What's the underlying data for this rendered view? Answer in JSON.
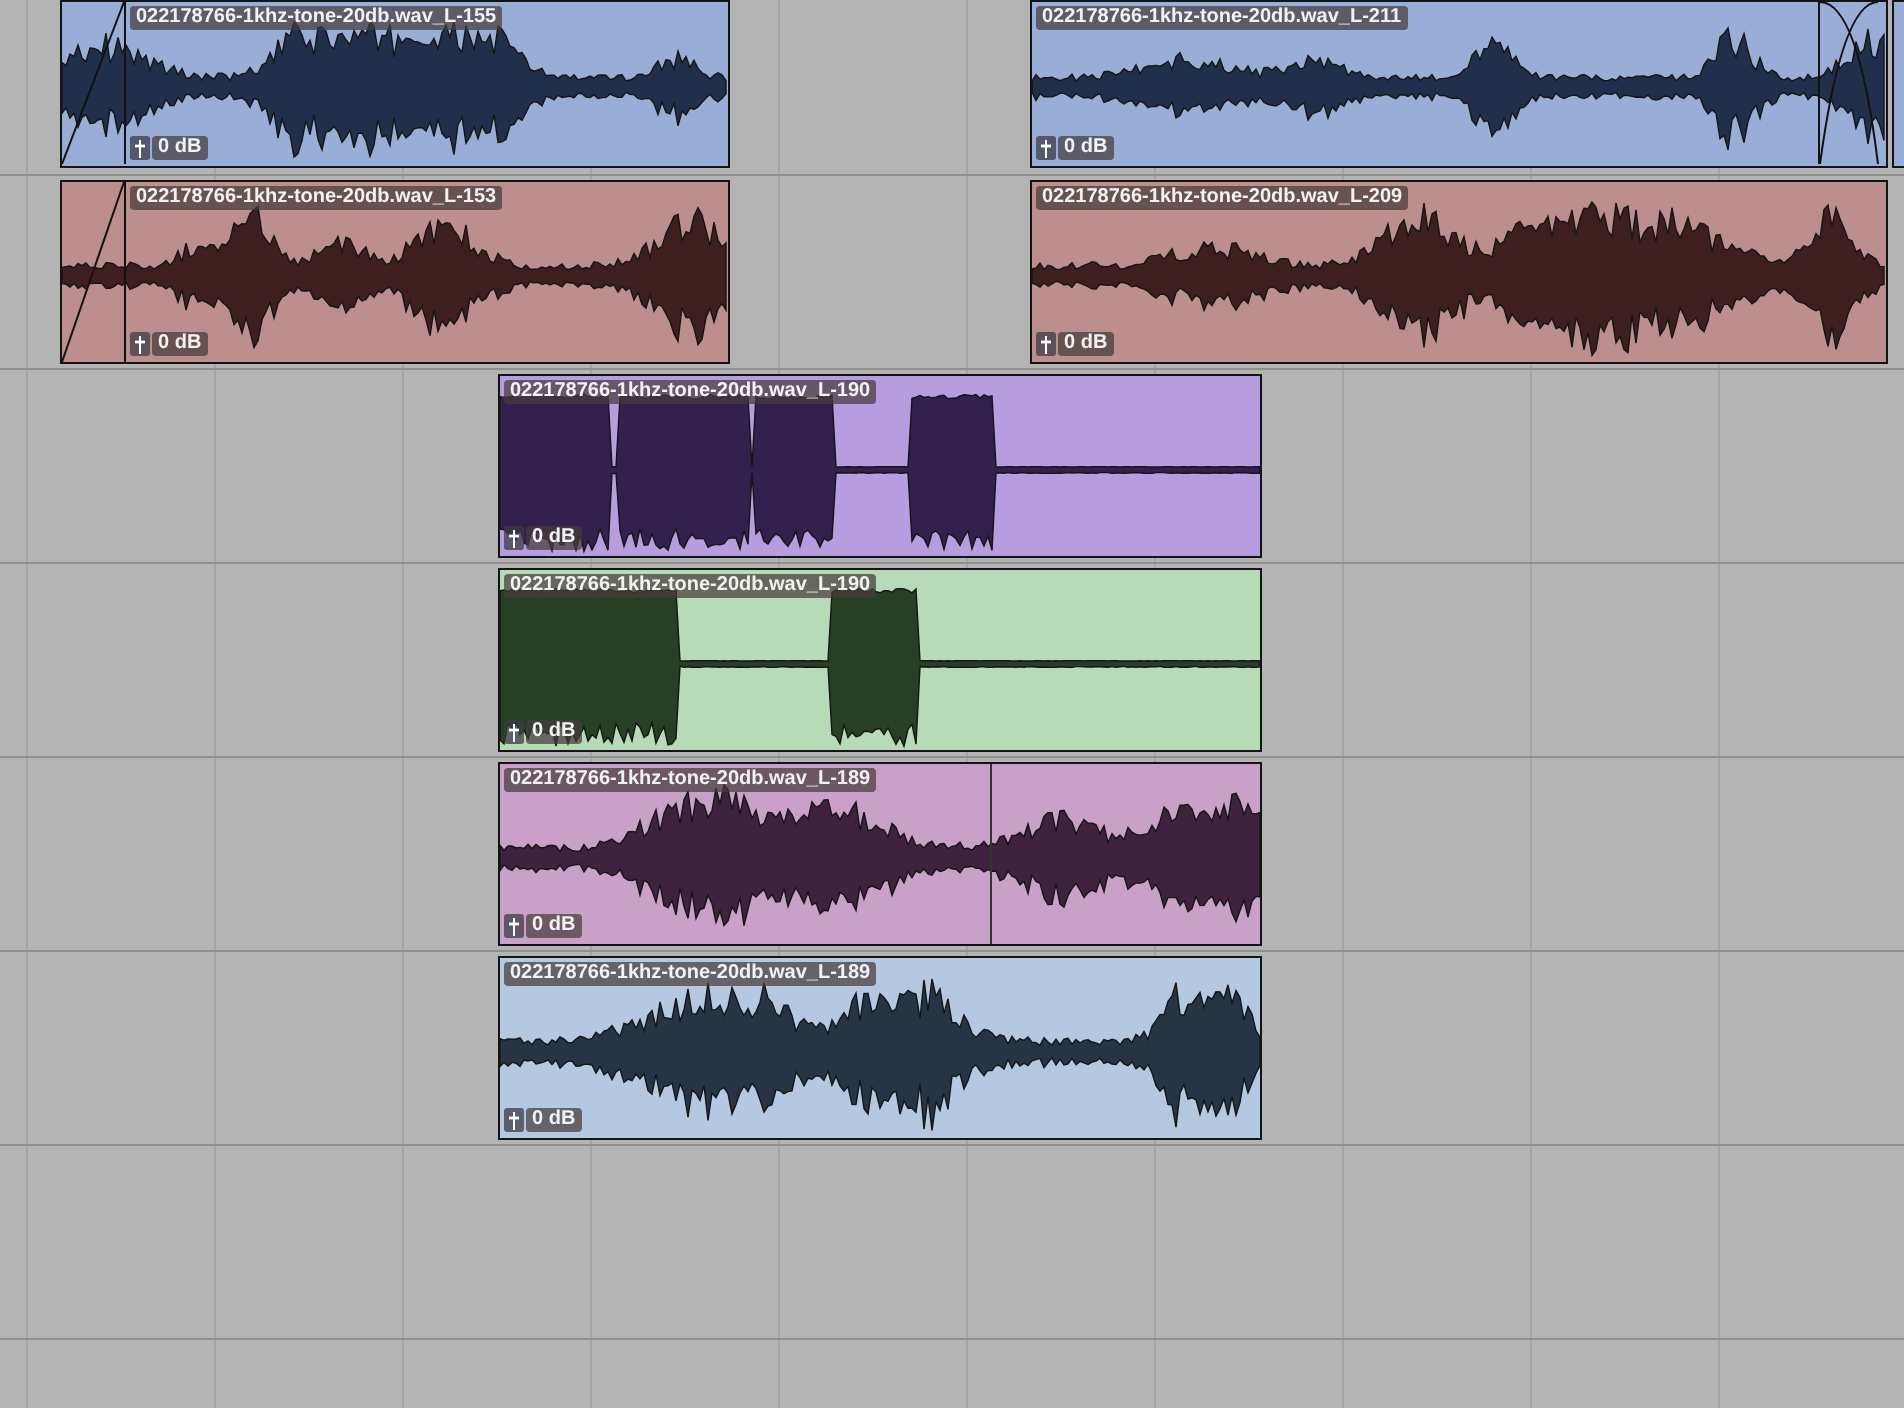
{
  "lanes": [
    {
      "clips": [
        {
          "name": "022178766-1khz-tone-20db.wav_L-155",
          "gain": "0 dB",
          "color": "#98aed6"
        },
        {
          "name": "022178766-1khz-tone-20db.wav_L-211",
          "gain": "0 dB",
          "color": "#98aed6"
        }
      ]
    },
    {
      "clips": [
        {
          "name": "022178766-1khz-tone-20db.wav_L-153",
          "gain": "0 dB",
          "color": "#bc8e8e"
        },
        {
          "name": "022178766-1khz-tone-20db.wav_L-209",
          "gain": "0 dB",
          "color": "#bc8e8e"
        }
      ]
    },
    {
      "clips": [
        {
          "name": "022178766-1khz-tone-20db.wav_L-190",
          "gain": "0 dB",
          "color": "#b59ddf"
        }
      ]
    },
    {
      "clips": [
        {
          "name": "022178766-1khz-tone-20db.wav_L-190",
          "gain": "0 dB",
          "color": "#b7dbb7"
        }
      ]
    },
    {
      "clips": [
        {
          "name": "022178766-1khz-tone-20db.wav_L-189",
          "gain": "0 dB",
          "color": "#c8a0c8"
        }
      ]
    },
    {
      "clips": [
        {
          "name": "022178766-1khz-tone-20db.wav_L-189",
          "gain": "0 dB",
          "color": "#b4c8e2"
        }
      ]
    }
  ]
}
